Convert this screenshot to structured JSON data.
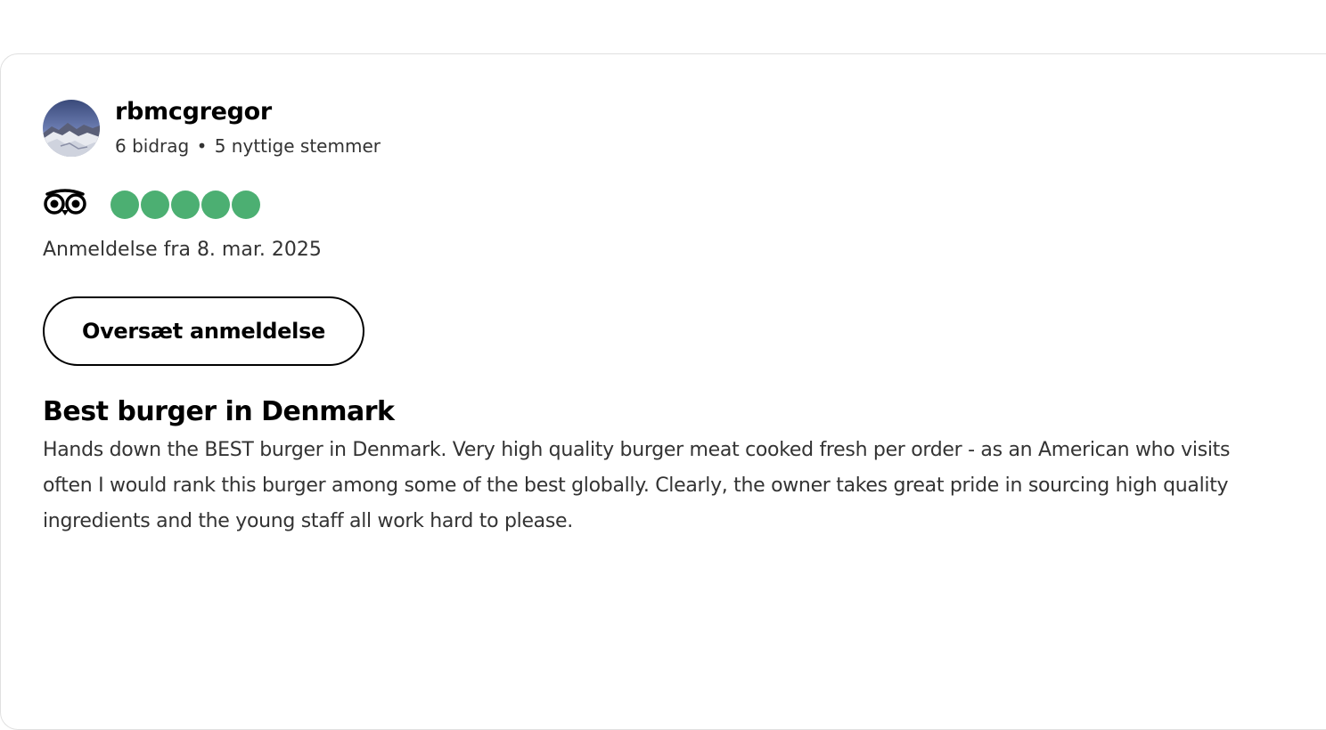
{
  "review": {
    "user": {
      "name": "rbmcgregor",
      "contributions": "6 bidrag",
      "separator": "•",
      "helpful_votes": "5 nyttige stemmer",
      "avatar_icon": "mountain-avatar-icon"
    },
    "rating": {
      "value": 5,
      "max": 5,
      "color": "#4caf72",
      "logo_icon": "tripadvisor-owl-icon"
    },
    "date": "Anmeldelse fra 8. mar. 2025",
    "translate_label": "Oversæt anmeldelse",
    "title": "Best burger in Denmark",
    "body": "Hands down the BEST burger in Denmark. Very high quality burger meat cooked fresh per order - as an American who visits often I would rank this burger among some of the best globally. Clearly, the owner takes great pride in sourcing high quality ingredients and the young staff all work hard to please."
  }
}
